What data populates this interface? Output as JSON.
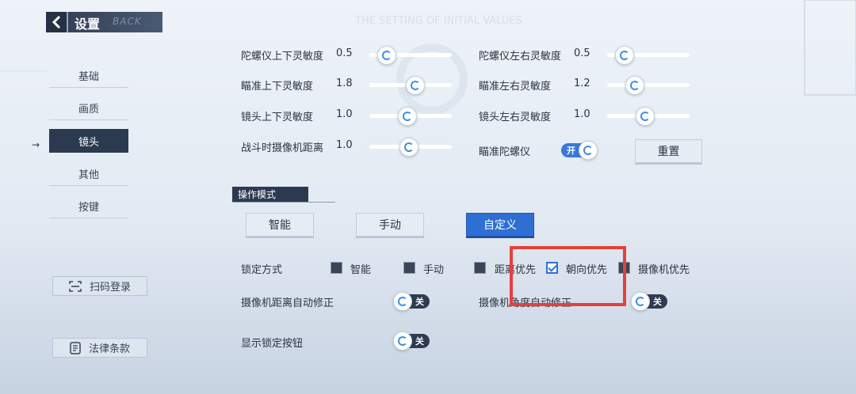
{
  "header": {
    "title": "设置",
    "ghost": "BACK"
  },
  "watermark": "THE SETTING OF INITIAL VALUES",
  "nav": {
    "items": [
      "基础",
      "画质",
      "镜头",
      "其他",
      "按键"
    ],
    "active": "镜头"
  },
  "side_buttons": {
    "scan_login": "扫码登录",
    "legal": "法律条款"
  },
  "sliders": {
    "gyro_vertical": {
      "label": "陀螺仪上下灵敏度",
      "value": "0.5",
      "fraction": 0.2
    },
    "gyro_horizontal": {
      "label": "陀螺仪左右灵敏度",
      "value": "0.5",
      "fraction": 0.2
    },
    "aim_vertical": {
      "label": "瞄准上下灵敏度",
      "value": "1.8",
      "fraction": 0.55
    },
    "aim_horizontal": {
      "label": "瞄准左右灵敏度",
      "value": "1.2",
      "fraction": 0.33
    },
    "lens_vertical": {
      "label": "镜头上下灵敏度",
      "value": "1.0",
      "fraction": 0.45
    },
    "lens_horizontal": {
      "label": "镜头左右灵敏度",
      "value": "1.0",
      "fraction": 0.45
    },
    "camera_distance": {
      "label": "战斗时摄像机距离",
      "value": "1.0",
      "fraction": 0.47
    }
  },
  "aim_gyro": {
    "label": "瞄准陀螺仪",
    "toggle": "开"
  },
  "reset_label": "重置",
  "operation_mode": {
    "title": "操作模式",
    "options": [
      "智能",
      "手动",
      "自定义"
    ],
    "selected": "自定义"
  },
  "lock_mode": {
    "label": "锁定方式",
    "options": [
      {
        "label": "智能",
        "checked": false
      },
      {
        "label": "手动",
        "checked": false
      },
      {
        "label": "距离优先",
        "checked": false
      },
      {
        "label": "朝向优先",
        "checked": true
      },
      {
        "label": "摄像机优先",
        "checked": false
      }
    ]
  },
  "auto_distance": {
    "label": "摄像机距离自动修正",
    "toggle": "关"
  },
  "auto_angle": {
    "label": "摄像机角度自动修正",
    "toggle": "关"
  },
  "show_lock_button": {
    "label": "显示锁定按钮",
    "toggle": "关"
  },
  "colors": {
    "accent": "#2f6fd3",
    "dark": "#2c3a50",
    "highlight": "#e5403a"
  }
}
